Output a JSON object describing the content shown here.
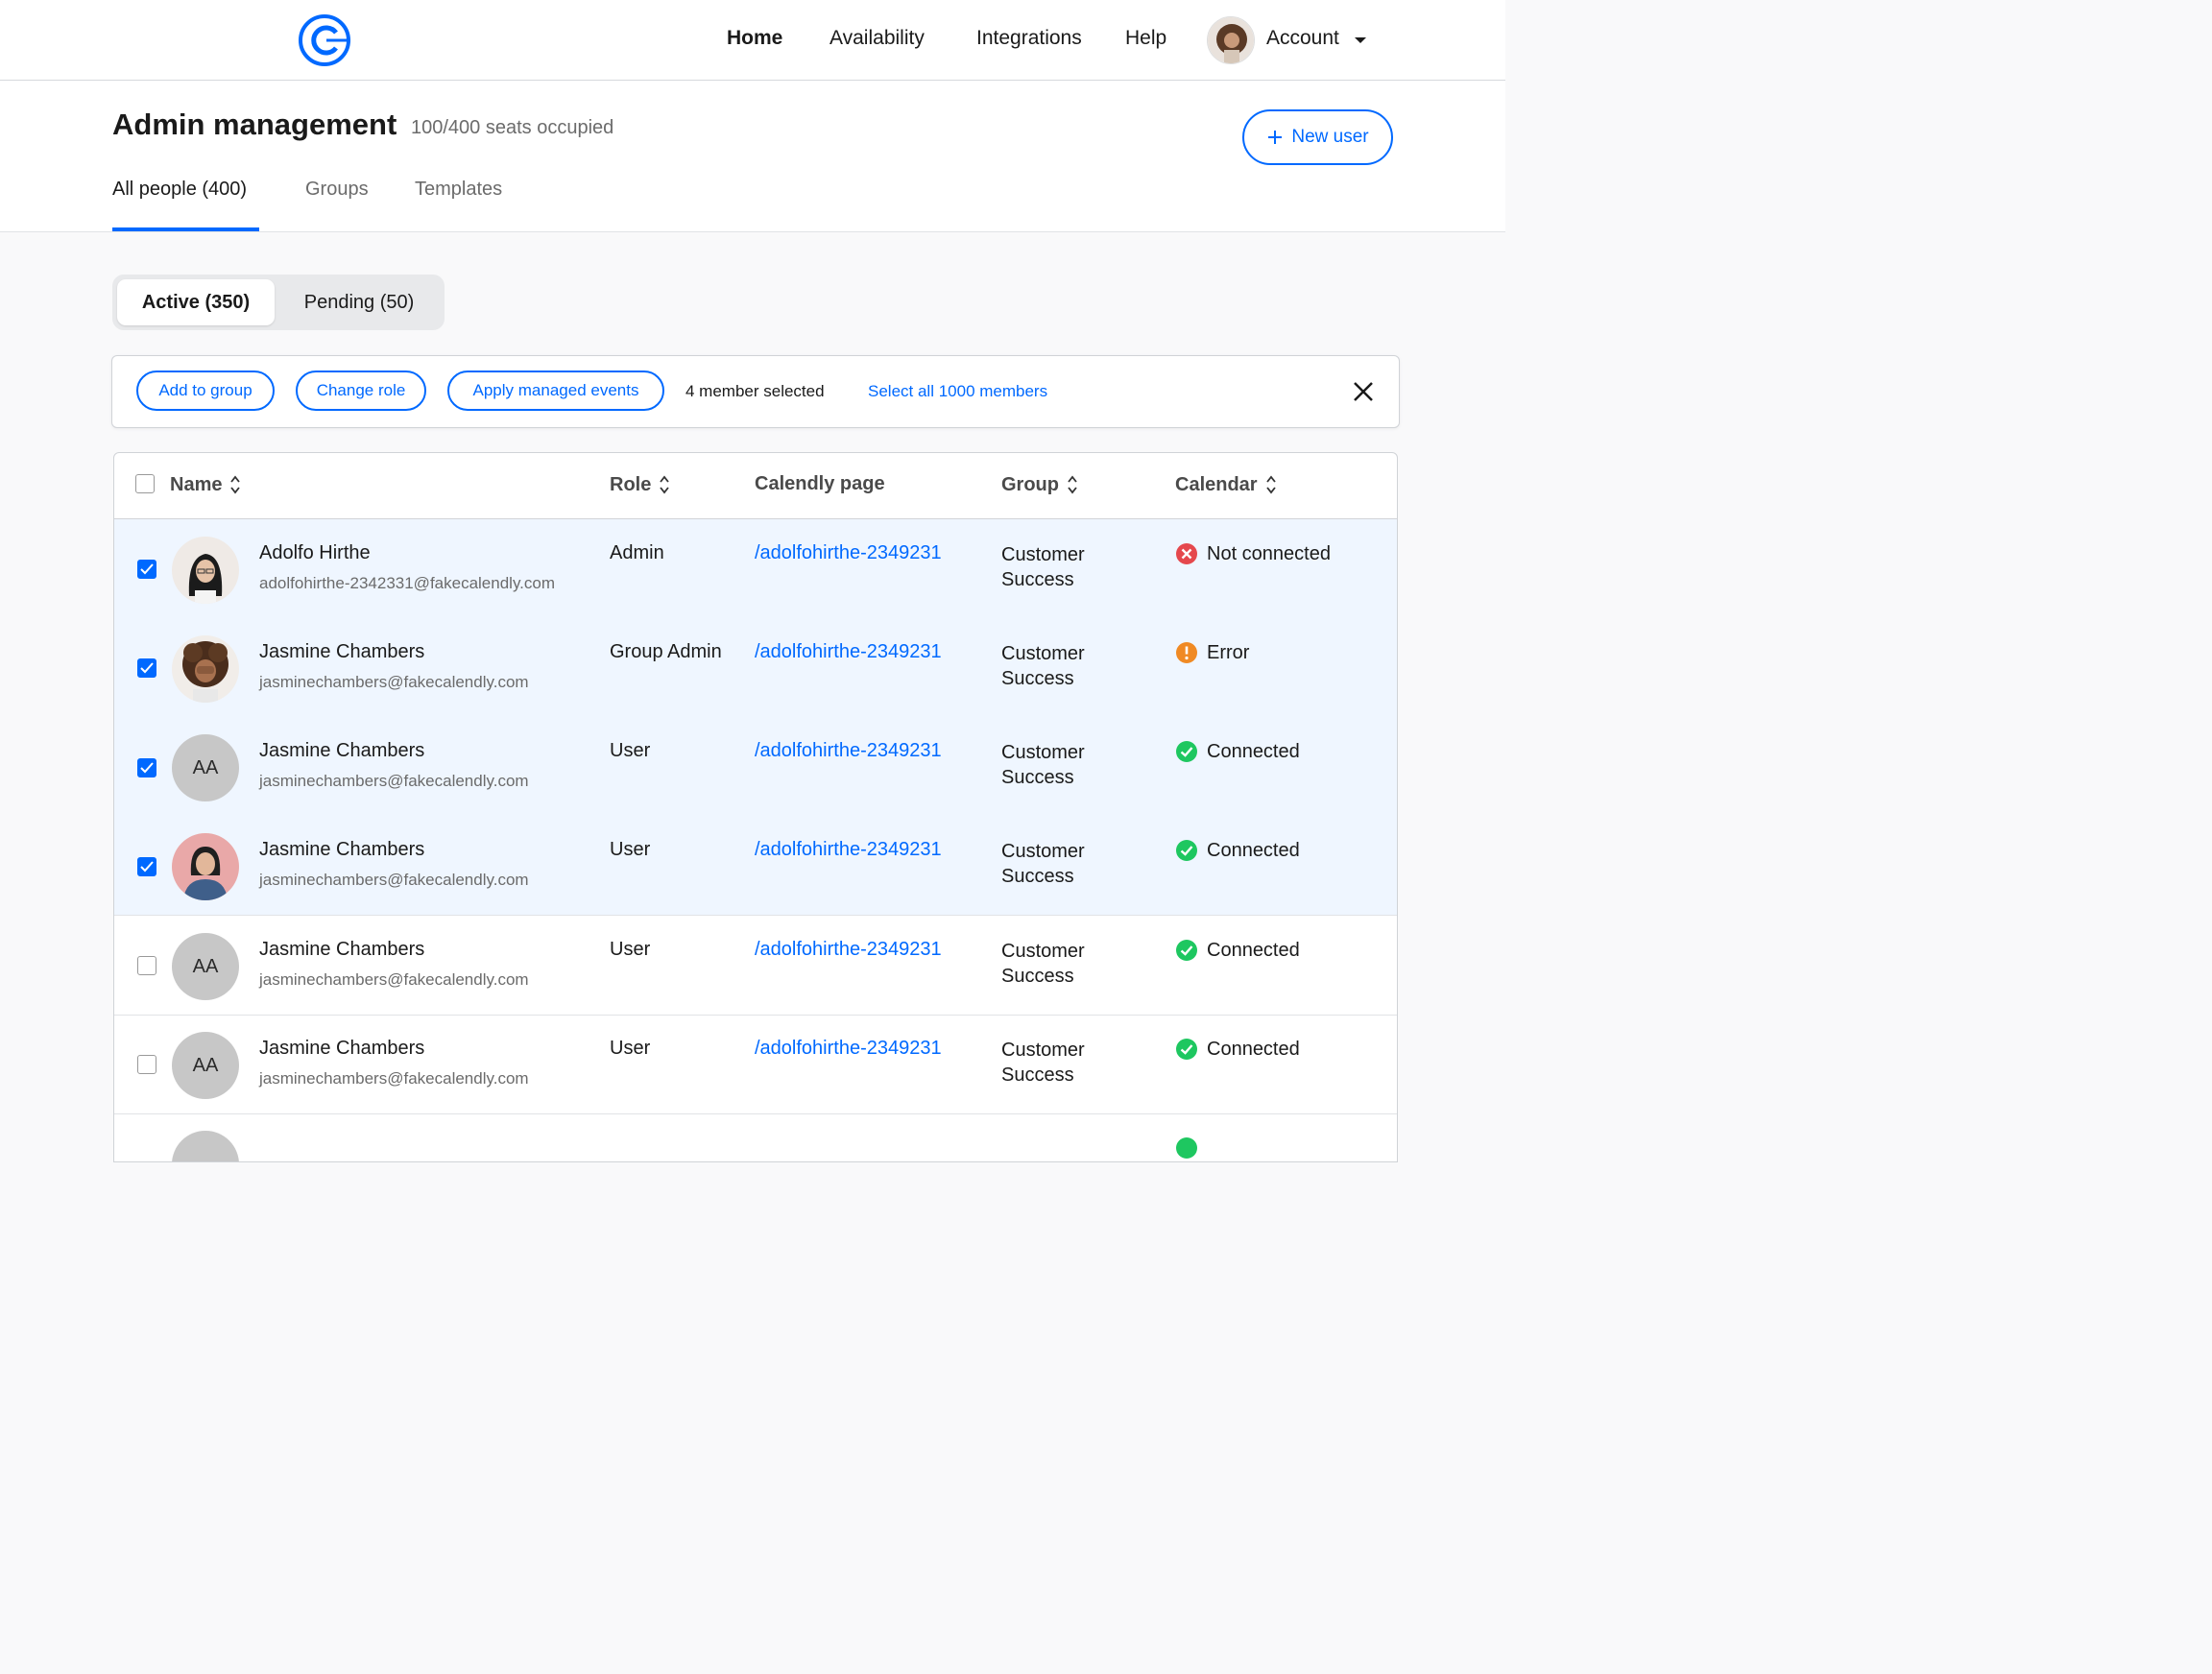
{
  "nav": {
    "items": [
      "Home",
      "Availability",
      "Integrations",
      "Help"
    ],
    "account_label": "Account"
  },
  "header": {
    "title": "Admin management",
    "seats": "100/400 seats occupied",
    "new_user_label": "New user",
    "tabs": [
      "All people (400)",
      "Groups",
      "Templates"
    ]
  },
  "segmented": {
    "active_label": "Active (350)",
    "pending_label": "Pending (50)"
  },
  "bulk": {
    "add_to_group": "Add to group",
    "change_role": "Change role",
    "apply_managed_events": "Apply managed events",
    "selected_text": "4 member selected",
    "select_all": "Select all 1000 members"
  },
  "table": {
    "columns": [
      "Name",
      "Role",
      "Calendly page",
      "Group",
      "Calendar"
    ],
    "rows": [
      {
        "name": "Adolfo Hirthe",
        "email": "adolfohirthe-2342331@fakecalendly.com",
        "role": "Admin",
        "page": "/adolfohirthe-2349231",
        "group_line1": "Customer",
        "group_line2": "Success",
        "calendar": "Not connected",
        "initials": ""
      },
      {
        "name": "Jasmine Chambers",
        "email": "jasminechambers@fakecalendly.com",
        "role": "Group Admin",
        "page": "/adolfohirthe-2349231",
        "group_line1": "Customer",
        "group_line2": "Success",
        "calendar": "Error",
        "initials": ""
      },
      {
        "name": "Jasmine Chambers",
        "email": "jasminechambers@fakecalendly.com",
        "role": "User",
        "page": "/adolfohirthe-2349231",
        "group_line1": "Customer",
        "group_line2": "Success",
        "calendar": "Connected",
        "initials": "AA"
      },
      {
        "name": "Jasmine Chambers",
        "email": "jasminechambers@fakecalendly.com",
        "role": "User",
        "page": "/adolfohirthe-2349231",
        "group_line1": "Customer",
        "group_line2": "Success",
        "calendar": "Connected",
        "initials": ""
      },
      {
        "name": "Jasmine Chambers",
        "email": "jasminechambers@fakecalendly.com",
        "role": "User",
        "page": "/adolfohirthe-2349231",
        "group_line1": "Customer",
        "group_line2": "Success",
        "calendar": "Connected",
        "initials": "AA"
      },
      {
        "name": "Jasmine Chambers",
        "email": "jasminechambers@fakecalendly.com",
        "role": "User",
        "page": "/adolfohirthe-2349231",
        "group_line1": "Customer",
        "group_line2": "Success",
        "calendar": "Connected",
        "initials": "AA"
      }
    ]
  },
  "colors": {
    "accent": "#0069ff",
    "selected_row": "#eff6ff",
    "status_connected": "#1ec760",
    "status_error": "#f08a24",
    "status_not_connected": "#e5484d"
  }
}
